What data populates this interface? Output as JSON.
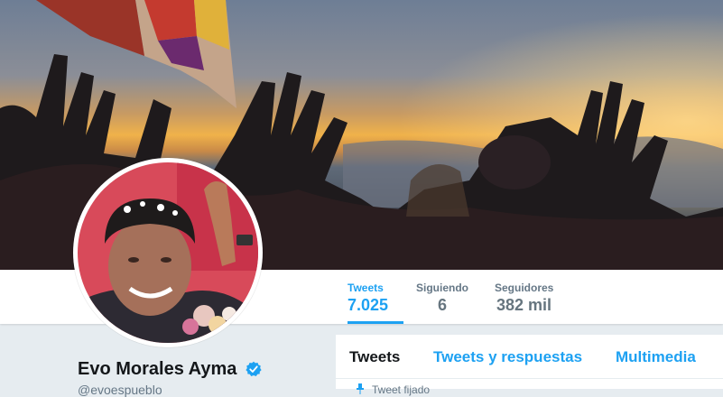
{
  "profile": {
    "name": "Evo Morales Ayma",
    "handle": "@evoespueblo",
    "verified": true
  },
  "stats": [
    {
      "label": "Tweets",
      "value": "7.025",
      "active": true
    },
    {
      "label": "Siguiendo",
      "value": "6",
      "active": false
    },
    {
      "label": "Seguidores",
      "value": "382 mil",
      "active": false
    }
  ],
  "tabs": [
    {
      "label": "Tweets",
      "active": true
    },
    {
      "label": "Tweets y respuestas",
      "active": false
    },
    {
      "label": "Multimedia",
      "active": false
    }
  ],
  "timeline": {
    "pinned_label": "Tweet fijado"
  },
  "colors": {
    "accent": "#1da1f2",
    "page_bg": "#e6ecf0",
    "text_dark": "#14171a",
    "text_muted": "#657786"
  },
  "icons": {
    "verified": "verified-badge-icon",
    "pin": "pin-icon"
  }
}
